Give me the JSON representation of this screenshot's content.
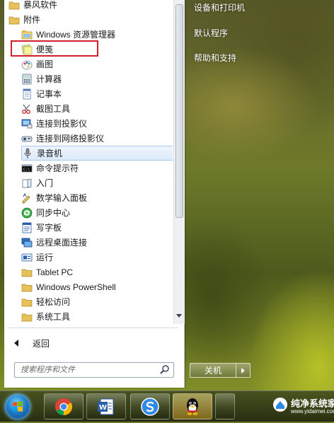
{
  "start_menu": {
    "programs": [
      {
        "label": "暴风软件",
        "icon": "folder-icon"
      },
      {
        "label": "附件",
        "icon": "folder-icon"
      },
      {
        "label": "Windows 资源管理器",
        "icon": "explorer-icon"
      },
      {
        "label": "便笺",
        "icon": "sticky-notes-icon"
      },
      {
        "label": "画图",
        "icon": "paint-icon"
      },
      {
        "label": "计算器",
        "icon": "calculator-icon"
      },
      {
        "label": "记事本",
        "icon": "notepad-icon"
      },
      {
        "label": "截图工具",
        "icon": "snipping-tool-icon"
      },
      {
        "label": "连接到投影仪",
        "icon": "projector-icon"
      },
      {
        "label": "连接到网络投影仪",
        "icon": "network-projector-icon"
      },
      {
        "label": "录音机",
        "icon": "microphone-icon"
      },
      {
        "label": "命令提示符",
        "icon": "cmd-icon"
      },
      {
        "label": "入门",
        "icon": "getting-started-icon"
      },
      {
        "label": "数学输入面板",
        "icon": "math-input-icon"
      },
      {
        "label": "同步中心",
        "icon": "sync-center-icon"
      },
      {
        "label": "写字板",
        "icon": "wordpad-icon"
      },
      {
        "label": "远程桌面连接",
        "icon": "remote-desktop-icon"
      },
      {
        "label": "运行",
        "icon": "run-icon"
      },
      {
        "label": "Tablet PC",
        "icon": "folder-icon"
      },
      {
        "label": "Windows PowerShell",
        "icon": "folder-icon"
      },
      {
        "label": "轻松访问",
        "icon": "folder-icon"
      },
      {
        "label": "系统工具",
        "icon": "folder-icon"
      }
    ],
    "selected_index": 10,
    "highlighted_index": 3,
    "back_label": "返回",
    "search_placeholder": "搜索程序和文件",
    "right_links": [
      {
        "label": "设备和打印机"
      },
      {
        "label": "默认程序"
      },
      {
        "label": "帮助和支持"
      }
    ],
    "shutdown_label": "关机"
  },
  "taskbar": {
    "pinned": [
      {
        "name": "chrome-icon"
      },
      {
        "name": "word-icon"
      },
      {
        "name": "sogou-browser-icon"
      },
      {
        "name": "qq-icon"
      }
    ]
  },
  "watermark": {
    "title": "纯净系统家园",
    "url": "www.yidaimei.com"
  },
  "colors": {
    "highlight_box": "#d0202a",
    "selected_bg": "#dceafa",
    "text": "#1a1a1a"
  }
}
